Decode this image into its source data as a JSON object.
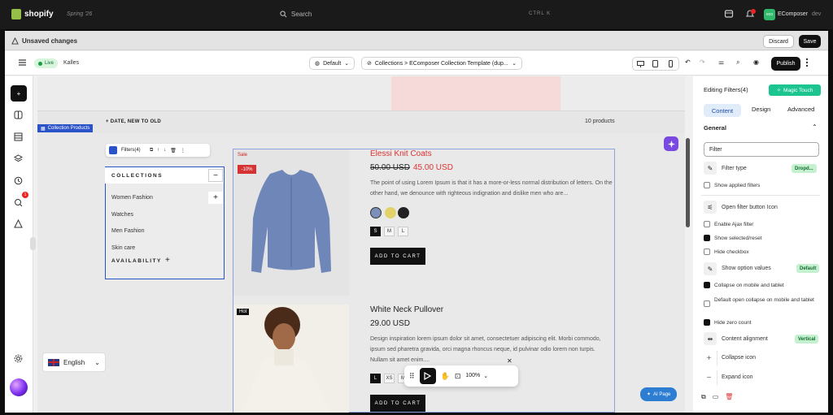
{
  "topbar": {
    "brand": "shopify",
    "edition": "Spring '26",
    "search": "Search",
    "shortcut": "CTRL  K",
    "store_initials": "eco",
    "store_name": "EComposer",
    "store_env": "dev"
  },
  "unsaved": {
    "text": "Unsaved changes",
    "discard": "Discard",
    "save": "Save"
  },
  "toolbar": {
    "live": "Live",
    "theme": "Kalles",
    "default": "Default",
    "template": "Collections  >  EComposer Collection Template (dup...",
    "publish": "Publish"
  },
  "rail": {
    "badge": "1"
  },
  "canvas": {
    "sort": "DATE, NEW TO OLD",
    "count": "10 products",
    "tag": "Collection Products",
    "filter_chip": "Filters(4)",
    "collections_title": "COLLECTIONS",
    "collections": [
      "Women Fashion",
      "Watches",
      "Men Fashion",
      "Skin care"
    ],
    "availability": "AVAILABILITY",
    "p1": {
      "sale": "Sale",
      "pct": "-10%",
      "title": "Elessi Knit Coats",
      "old": "50.00 USD",
      "new": "45.00 USD",
      "desc": "The point of using Lorem Ipsum is that it has a more-or-less normal distribution of letters. On the other hand, we denounce with righteous indignation and dislike men who are...",
      "sizes": [
        "S",
        "M",
        "L"
      ],
      "cart": "ADD TO CART"
    },
    "p2": {
      "hot": "Hot",
      "title": "White Neck Pullover",
      "price": "29.00 USD",
      "desc": "Design inspiration lorem ipsum dolor sit amet, consectetuer adipiscing elit. Morbi commodo, ipsum sed pharetra gravida, orci magna rhoncus neque, id pulvinar odio lorem non turpis. Nullam sit amet enim....",
      "sizes": [
        "L",
        "XS",
        "M"
      ],
      "cart": "ADD TO CART"
    },
    "zoom": "100%",
    "ai_page": "AI Page",
    "language": "English"
  },
  "panel": {
    "title": "Editing Filters(4)",
    "magic": "Magic Touch",
    "tabs": [
      "Content",
      "Design",
      "Advanced"
    ],
    "section": "General",
    "filter_value": "Filter",
    "filter_type": "Filter type",
    "filter_type_badge": "Dropd...",
    "show_applied": "Show applied filters",
    "open_icon": "Open filter button Icon",
    "enable_ajax": "Enable Ajax filter",
    "show_selected": "Show selected/reset",
    "hide_checkbox": "Hide checkbox",
    "show_option": "Show option values",
    "show_option_badge": "Default",
    "collapse_mobile": "Collapse on mobile and tablet",
    "default_open": "Default open collapse on mobile and tablet",
    "hide_zero": "Hide zero count",
    "content_align": "Content alignment",
    "content_align_badge": "Vertical",
    "collapse_icon": "Collapse icon",
    "expand_icon": "Expand icon"
  },
  "colors": {
    "accent": "#2b53c9",
    "sale": "#d33333",
    "green": "#1cc58f"
  }
}
